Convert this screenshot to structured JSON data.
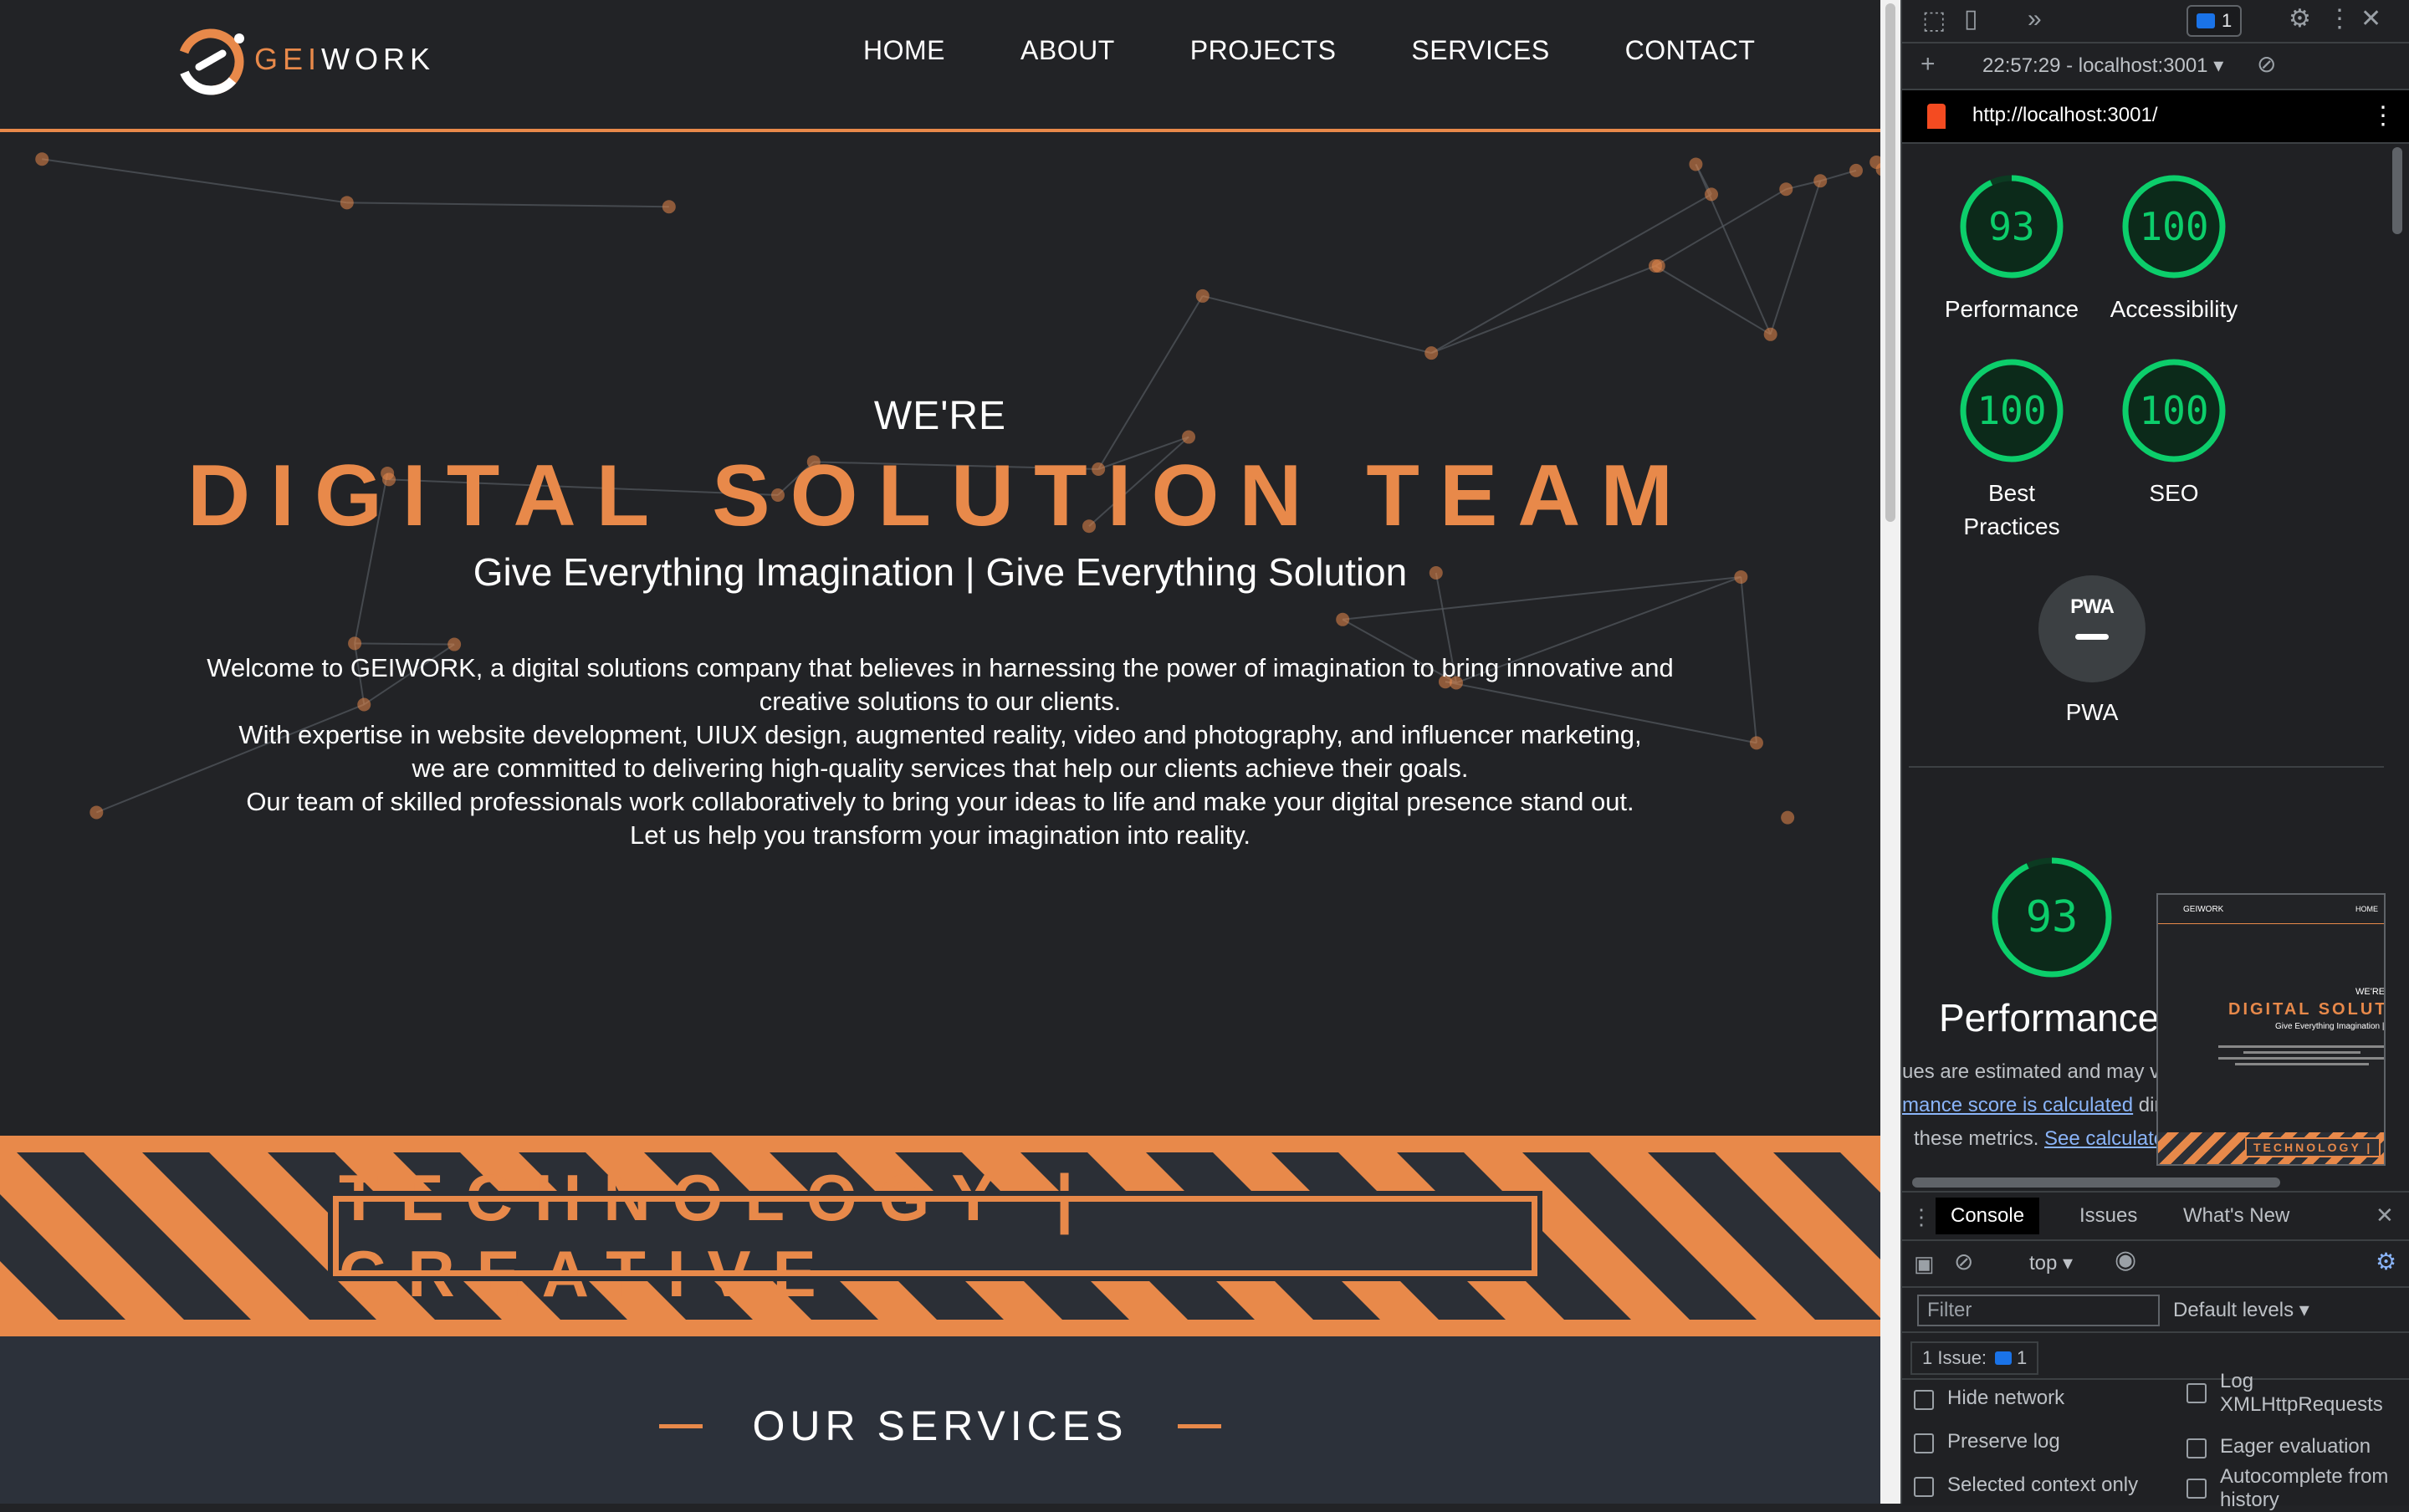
{
  "site": {
    "logo": {
      "prefix": "GEI",
      "suffix": "WORK"
    },
    "nav": [
      "HOME",
      "ABOUT",
      "PROJECTS",
      "SERVICES",
      "CONTACT"
    ],
    "hero": {
      "kicker": "WE'RE",
      "headline": "DIGITAL SOLUTION TEAM",
      "tagline": "Give Everything Imagination | Give Everything Solution",
      "description": [
        "Welcome to GEIWORK, a digital solutions company that believes in harnessing the power of imagination to bring innovative and",
        "creative solutions to our clients.",
        "With expertise in website development, UIUX design, augmented reality, video and photography, and influencer marketing,",
        "we are committed to delivering high-quality services that help our clients achieve their goals.",
        "Our team of skilled professionals work collaboratively to bring your ideas to life and make your digital presence stand out.",
        "Let us help you transform your imagination into reality."
      ]
    },
    "band_text": "TECHNOLOGY | CREATIVE",
    "services_title": "OUR SERVICES",
    "colors": {
      "accent": "#e8894a",
      "background": "#222326",
      "band_dark": "#2b2f36",
      "services_bg": "#2c313a"
    }
  },
  "devtools": {
    "issues_count": "1",
    "report_time": "22:57:29 - localhost:3001",
    "url": "http://localhost:3001/",
    "scores": [
      {
        "label": "Performance",
        "value": "93"
      },
      {
        "label": "Accessibility",
        "value": "100"
      },
      {
        "label": "Best Practices",
        "value": "100"
      },
      {
        "label": "SEO",
        "value": "100"
      }
    ],
    "pwa": {
      "badge": "PWA",
      "label": "PWA"
    },
    "performance": {
      "score": "93",
      "title": "Performance",
      "line1": "ues are estimated and may va",
      "line2_link": "mance score is calculated",
      "line2_rest": " dir",
      "line3": "these metrics. ",
      "line3_link": "See calculato"
    },
    "thumbnail": {
      "brand": "GEIWORK",
      "nav": "HOME",
      "kicker": "WE'RE",
      "headline": "DIGITAL SOLUT",
      "tagline": "Give Everything Imagination | Gi",
      "band": "TECHNOLOGY |"
    },
    "drawer": {
      "tabs": [
        "Console",
        "Issues",
        "What's New"
      ],
      "context": "top",
      "filter_placeholder": "Filter",
      "levels": "Default levels",
      "issues_label": "1 Issue:",
      "issues_count": "1",
      "checkboxes_left": [
        "Hide network",
        "Preserve log",
        "Selected context only"
      ],
      "checkboxes_right": [
        "Log XMLHttpRequests",
        "Eager evaluation",
        "Autocomplete from history"
      ]
    },
    "colors": {
      "score_good": "#0cce6b",
      "link": "#8ab4f8"
    }
  }
}
